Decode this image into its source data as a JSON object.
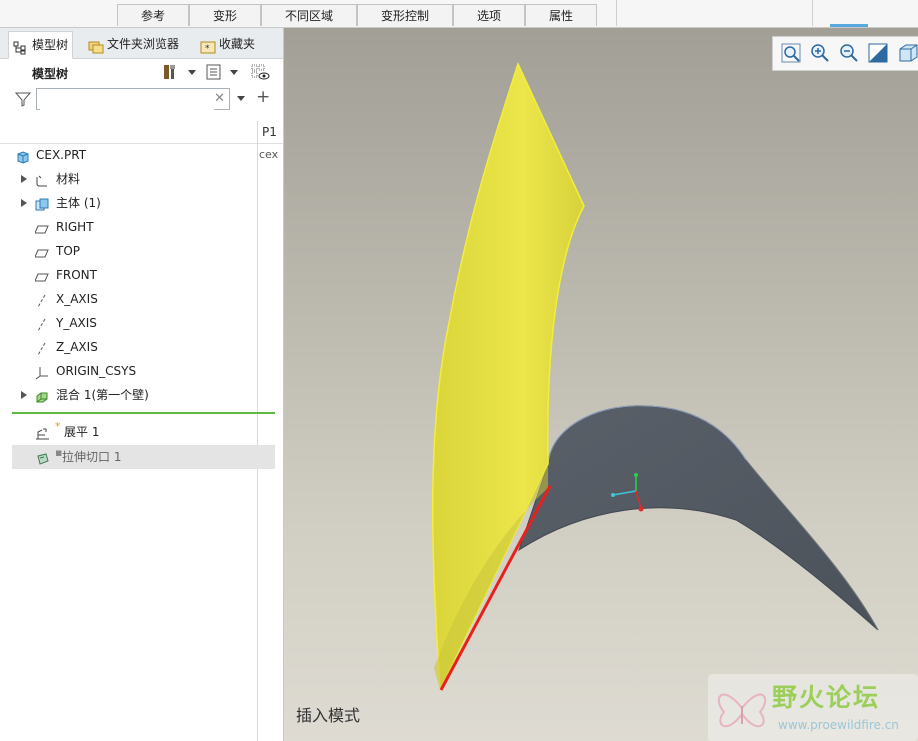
{
  "ribbon": {
    "tabs": [
      "参考",
      "变形",
      "不同区域",
      "变形控制",
      "选项",
      "属性"
    ]
  },
  "panel_tabs": [
    {
      "label": "模型树",
      "icon": "tree-icon",
      "active": true
    },
    {
      "label": "文件夹浏览器",
      "icon": "folder-icon",
      "active": false
    },
    {
      "label": "收藏夹",
      "icon": "favorites-icon",
      "active": false
    }
  ],
  "model_tree": {
    "title": "模型树",
    "search": {
      "value": "",
      "placeholder": ""
    },
    "column_header": "P1",
    "items": [
      {
        "label": "CEX.PRT",
        "icon": "part-icon",
        "col": "cex"
      },
      {
        "label": "材料",
        "icon": "material-icon",
        "expandable": true
      },
      {
        "label": "主体 (1)",
        "icon": "body-icon",
        "expandable": true
      },
      {
        "label": "RIGHT",
        "icon": "datum-plane-icon"
      },
      {
        "label": "TOP",
        "icon": "datum-plane-icon"
      },
      {
        "label": "FRONT",
        "icon": "datum-plane-icon"
      },
      {
        "label": "X_AXIS",
        "icon": "datum-axis-icon"
      },
      {
        "label": "Y_AXIS",
        "icon": "datum-axis-icon"
      },
      {
        "label": "Z_AXIS",
        "icon": "datum-axis-icon"
      },
      {
        "label": "ORIGIN_CSYS",
        "icon": "csys-icon"
      },
      {
        "label": "混合 1(第一个壁)",
        "icon": "blend-icon",
        "expandable": true
      }
    ],
    "after_insert": [
      {
        "label": "展平 1",
        "icon": "flatten-icon"
      },
      {
        "label": "拉伸切口 1",
        "icon": "extrude-cut-icon",
        "selected": true
      }
    ]
  },
  "viewport": {
    "status": "插入模式",
    "view_tools": [
      "refit-icon",
      "zoom-in-icon",
      "zoom-out-icon",
      "repaint-icon",
      "view-icon"
    ]
  },
  "watermark": {
    "title": "野火论坛",
    "url": "www.proewildfire.cn"
  },
  "colors": {
    "surface_yellow": "#e6e23a",
    "surface_dark": "#5d6269",
    "edge_red": "#e8211e",
    "insert_line": "#5cba3c"
  }
}
